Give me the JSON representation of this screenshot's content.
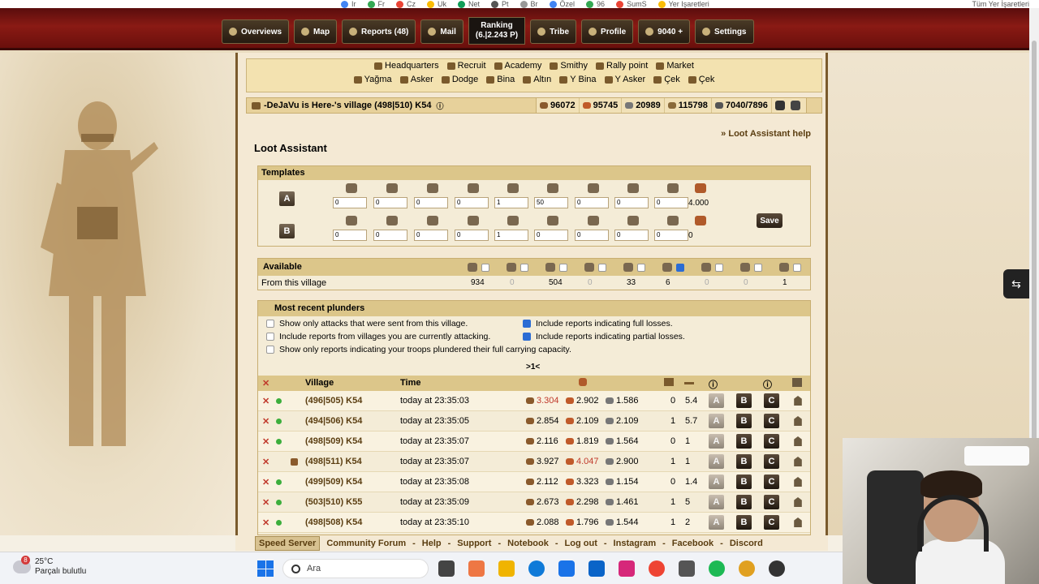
{
  "bookmarks": {
    "items": [
      "Ir",
      "Fr",
      "Cz",
      "Uk",
      "Net",
      "Pt",
      "Br",
      "Özel",
      "96",
      "SumS",
      "Yer Işaretleri"
    ],
    "right": "Tüm Yer İşaretleri"
  },
  "topmenu": {
    "overviews": "Overviews",
    "map": "Map",
    "reports": "Reports (48)",
    "mail": "Mail",
    "ranking_label": "Ranking",
    "ranking_value": "(6.|2.243 P)",
    "tribe": "Tribe",
    "profile": "Profile",
    "premium": "9040 +",
    "settings": "Settings"
  },
  "building_nav": {
    "row1": [
      "Headquarters",
      "Recruit",
      "Academy",
      "Smithy",
      "Rally point",
      "Market"
    ],
    "row2": [
      "Yağma",
      "Asker",
      "Dodge",
      "Bina",
      "Altın",
      "Y Bina",
      "Y Asker",
      "Çek",
      "Çek"
    ]
  },
  "village": {
    "name": "-DeJaVu is Here-'s village (498|510) K54",
    "resources": {
      "wood": "96072",
      "clay": "95745",
      "iron": "20989",
      "storage": "115798",
      "pop": "7040/7896"
    }
  },
  "loot": {
    "title": "Loot Assistant",
    "help": "» Loot Assistant help",
    "templates_header": "Templates",
    "template_a": {
      "label": "A",
      "values": [
        "0",
        "0",
        "0",
        "0",
        "1",
        "50",
        "0",
        "0",
        "0"
      ],
      "haul": "4.000"
    },
    "template_b": {
      "label": "B",
      "values": [
        "0",
        "0",
        "0",
        "0",
        "1",
        "0",
        "0",
        "0",
        "0"
      ],
      "haul": "0"
    },
    "save": "Save",
    "available_header": "Available",
    "from_village": "From this village",
    "available_values": [
      "934",
      "0",
      "504",
      "0",
      "33",
      "6",
      "0",
      "0",
      "1"
    ],
    "available_checked": [
      false,
      false,
      false,
      false,
      false,
      true,
      false,
      false,
      false
    ],
    "plunders_header": "Most recent plunders",
    "options": [
      {
        "text": "Show only attacks that were sent from this village.",
        "checked": false
      },
      {
        "text": "Include reports from villages you are currently attacking.",
        "checked": false
      },
      {
        "text": "Show only reports indicating your troops plundered their full carrying capacity.",
        "checked": false
      },
      {
        "text": "Include reports indicating full losses.",
        "checked": true
      },
      {
        "text": "Include reports indicating partial losses.",
        "checked": true
      }
    ],
    "pager": ">1<",
    "columns": {
      "village": "Village",
      "time": "Time"
    },
    "rows": [
      {
        "village": "(496|505) K54",
        "time": "today at 23:35:03",
        "wood": "3.304",
        "wood_red": true,
        "clay": "2.902",
        "clay_red": false,
        "iron": "1.586",
        "wall": "0",
        "dist": "5.4",
        "special": false
      },
      {
        "village": "(494|506) K54",
        "time": "today at 23:35:05",
        "wood": "2.854",
        "wood_red": false,
        "clay": "2.109",
        "clay_red": false,
        "iron": "2.109",
        "wall": "1",
        "dist": "5.7",
        "special": false
      },
      {
        "village": "(498|509) K54",
        "time": "today at 23:35:07",
        "wood": "2.116",
        "wood_red": false,
        "clay": "1.819",
        "clay_red": false,
        "iron": "1.564",
        "wall": "0",
        "dist": "1",
        "special": false
      },
      {
        "village": "(498|511) K54",
        "time": "today at 23:35:07",
        "wood": "3.927",
        "wood_red": false,
        "clay": "4.047",
        "clay_red": true,
        "iron": "2.900",
        "wall": "1",
        "dist": "1",
        "special": true
      },
      {
        "village": "(499|509) K54",
        "time": "today at 23:35:08",
        "wood": "2.112",
        "wood_red": false,
        "clay": "3.323",
        "clay_red": false,
        "iron": "1.154",
        "wall": "0",
        "dist": "1.4",
        "special": false
      },
      {
        "village": "(503|510) K55",
        "time": "today at 23:35:09",
        "wood": "2.673",
        "wood_red": false,
        "clay": "2.298",
        "clay_red": false,
        "iron": "1.461",
        "wall": "1",
        "dist": "5",
        "special": false
      },
      {
        "village": "(498|508) K54",
        "time": "today at 23:35:10",
        "wood": "2.088",
        "wood_red": false,
        "clay": "1.796",
        "clay_red": false,
        "iron": "1.544",
        "wall": "1",
        "dist": "2",
        "special": false
      }
    ],
    "btn_a": "A",
    "btn_b": "B",
    "btn_c": "C"
  },
  "footer": [
    "Speed Server",
    "Community Forum",
    "Help",
    "Support",
    "Notebook",
    "Log out",
    "Instagram",
    "Facebook",
    "Discord"
  ],
  "taskbar": {
    "temp": "25°C",
    "weather": "Parçalı bulutlu",
    "notif": "8",
    "search_placeholder": "Ara"
  },
  "colors": {
    "menu_red": "#8a1a14",
    "panel": "#f4e9d4",
    "header": "#dcc68a",
    "red_value": "#c0392b"
  }
}
